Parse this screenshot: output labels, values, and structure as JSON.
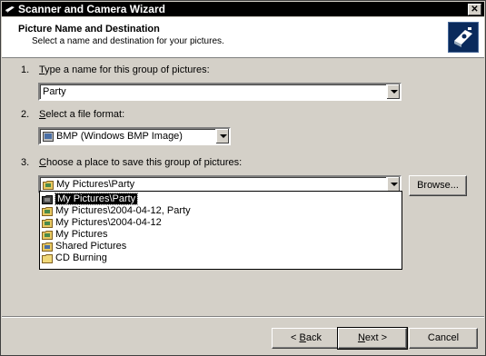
{
  "window": {
    "title": "Scanner and Camera Wizard",
    "close_glyph": "✕"
  },
  "header": {
    "title": "Picture Name and Destination",
    "subtitle": "Select a name and destination for your pictures."
  },
  "step1": {
    "number": "1.",
    "label_first": "T",
    "label_rest": "ype a name for this group of pictures:",
    "value": "Party"
  },
  "step2": {
    "number": "2.",
    "label_first": "S",
    "label_rest": "elect a file format:",
    "value": "BMP (Windows BMP Image)"
  },
  "step3": {
    "number": "3.",
    "label_first": "C",
    "label_rest": "hoose a place to save this group of pictures:",
    "value": "My Pictures\\Party",
    "options": [
      {
        "label": "My Pictures\\Party",
        "selected": true
      },
      {
        "label": "My Pictures\\2004-04-12, Party"
      },
      {
        "label": "My Pictures\\2004-04-12"
      },
      {
        "label": "My Pictures"
      },
      {
        "label": "Shared Pictures"
      },
      {
        "label": "CD Burning"
      }
    ]
  },
  "buttons": {
    "browse": "Browse...",
    "back_prefix": "< ",
    "back_mnemonic": "B",
    "back_rest": "ack",
    "next_mnemonic": "N",
    "next_rest": "ext >",
    "cancel": "Cancel"
  }
}
